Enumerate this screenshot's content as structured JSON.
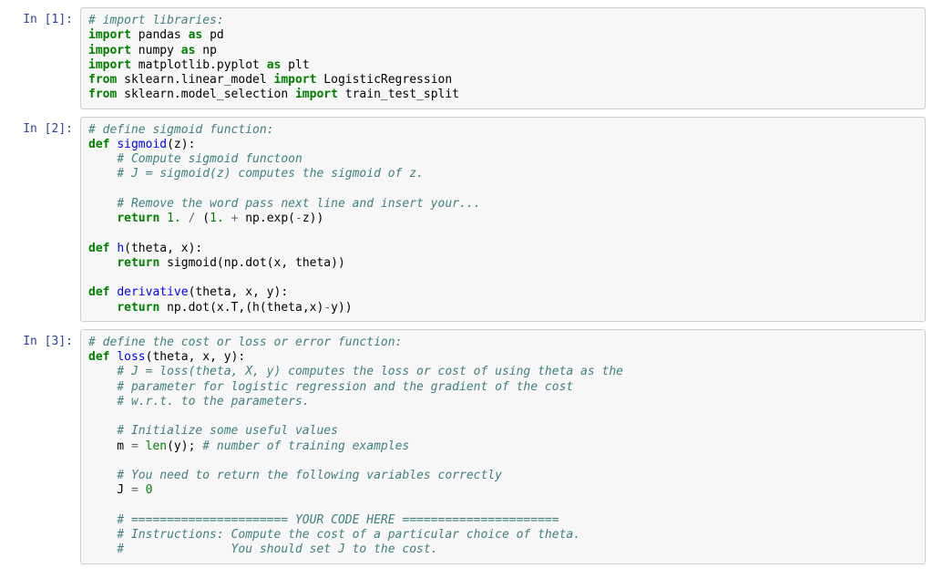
{
  "cells": [
    {
      "prompt": "In [1]:",
      "tokens": [
        {
          "t": "# import libraries:",
          "cls": "c"
        },
        {
          "t": "\n"
        },
        {
          "t": "import",
          "cls": "kn"
        },
        {
          "t": " pandas "
        },
        {
          "t": "as",
          "cls": "kn"
        },
        {
          "t": " pd\n"
        },
        {
          "t": "import",
          "cls": "kn"
        },
        {
          "t": " numpy "
        },
        {
          "t": "as",
          "cls": "kn"
        },
        {
          "t": " np\n"
        },
        {
          "t": "import",
          "cls": "kn"
        },
        {
          "t": " matplotlib.pyplot "
        },
        {
          "t": "as",
          "cls": "kn"
        },
        {
          "t": " plt\n"
        },
        {
          "t": "from",
          "cls": "kn"
        },
        {
          "t": " sklearn.linear_model "
        },
        {
          "t": "import",
          "cls": "kn"
        },
        {
          "t": " LogisticRegression\n"
        },
        {
          "t": "from",
          "cls": "kn"
        },
        {
          "t": " sklearn.model_selection "
        },
        {
          "t": "import",
          "cls": "kn"
        },
        {
          "t": " train_test_split"
        }
      ]
    },
    {
      "prompt": "In [2]:",
      "tokens": [
        {
          "t": "# define sigmoid function:",
          "cls": "c"
        },
        {
          "t": "\n"
        },
        {
          "t": "def",
          "cls": "kw"
        },
        {
          "t": " "
        },
        {
          "t": "sigmoid",
          "cls": "nf"
        },
        {
          "t": "(z):\n"
        },
        {
          "t": "    "
        },
        {
          "t": "# Compute sigmoid functoon",
          "cls": "c"
        },
        {
          "t": "\n"
        },
        {
          "t": "    "
        },
        {
          "t": "# J = sigmoid(z) computes the sigmoid of z.",
          "cls": "c"
        },
        {
          "t": "\n\n"
        },
        {
          "t": "    "
        },
        {
          "t": "# Remove the word pass next line and insert your...",
          "cls": "c"
        },
        {
          "t": "\n"
        },
        {
          "t": "    "
        },
        {
          "t": "return",
          "cls": "kw"
        },
        {
          "t": " "
        },
        {
          "t": "1.",
          "cls": "mi"
        },
        {
          "t": " "
        },
        {
          "t": "/",
          "cls": "op"
        },
        {
          "t": " ("
        },
        {
          "t": "1.",
          "cls": "mi"
        },
        {
          "t": " "
        },
        {
          "t": "+",
          "cls": "op"
        },
        {
          "t": " np.exp("
        },
        {
          "t": "-",
          "cls": "op"
        },
        {
          "t": "z))\n\n"
        },
        {
          "t": "def",
          "cls": "kw"
        },
        {
          "t": " "
        },
        {
          "t": "h",
          "cls": "nf"
        },
        {
          "t": "(theta, x):\n"
        },
        {
          "t": "    "
        },
        {
          "t": "return",
          "cls": "kw"
        },
        {
          "t": " sigmoid(np.dot(x, theta))\n\n"
        },
        {
          "t": "def",
          "cls": "kw"
        },
        {
          "t": " "
        },
        {
          "t": "derivative",
          "cls": "nf"
        },
        {
          "t": "(theta, x, y):\n"
        },
        {
          "t": "    "
        },
        {
          "t": "return",
          "cls": "kw"
        },
        {
          "t": " np.dot(x.T,(h(theta,x)"
        },
        {
          "t": "-",
          "cls": "op"
        },
        {
          "t": "y))"
        }
      ]
    },
    {
      "prompt": "In [3]:",
      "tokens": [
        {
          "t": "# define the cost or loss or error function:",
          "cls": "c"
        },
        {
          "t": "\n"
        },
        {
          "t": "def",
          "cls": "kw"
        },
        {
          "t": " "
        },
        {
          "t": "loss",
          "cls": "nf"
        },
        {
          "t": "(theta, x, y):\n"
        },
        {
          "t": "    "
        },
        {
          "t": "# J = loss(theta, X, y) computes the loss or cost of using theta as the",
          "cls": "c"
        },
        {
          "t": "\n"
        },
        {
          "t": "    "
        },
        {
          "t": "# parameter for logistic regression and the gradient of the cost",
          "cls": "c"
        },
        {
          "t": "\n"
        },
        {
          "t": "    "
        },
        {
          "t": "# w.r.t. to the parameters.",
          "cls": "c"
        },
        {
          "t": "\n\n"
        },
        {
          "t": "    "
        },
        {
          "t": "# Initialize some useful values",
          "cls": "c"
        },
        {
          "t": "\n"
        },
        {
          "t": "    m "
        },
        {
          "t": "=",
          "cls": "op"
        },
        {
          "t": " "
        },
        {
          "t": "len",
          "cls": "nb"
        },
        {
          "t": "(y); "
        },
        {
          "t": "# number of training examples",
          "cls": "c"
        },
        {
          "t": "\n\n"
        },
        {
          "t": "    "
        },
        {
          "t": "# You need to return the following variables correctly",
          "cls": "c"
        },
        {
          "t": "\n"
        },
        {
          "t": "    J "
        },
        {
          "t": "=",
          "cls": "op"
        },
        {
          "t": " "
        },
        {
          "t": "0",
          "cls": "mi"
        },
        {
          "t": "\n\n"
        },
        {
          "t": "    "
        },
        {
          "t": "# ====================== YOUR CODE HERE ======================",
          "cls": "c"
        },
        {
          "t": "\n"
        },
        {
          "t": "    "
        },
        {
          "t": "# Instructions: Compute the cost of a particular choice of theta.",
          "cls": "c"
        },
        {
          "t": "\n"
        },
        {
          "t": "    "
        },
        {
          "t": "#               You should set J to the cost.",
          "cls": "c"
        }
      ]
    }
  ]
}
